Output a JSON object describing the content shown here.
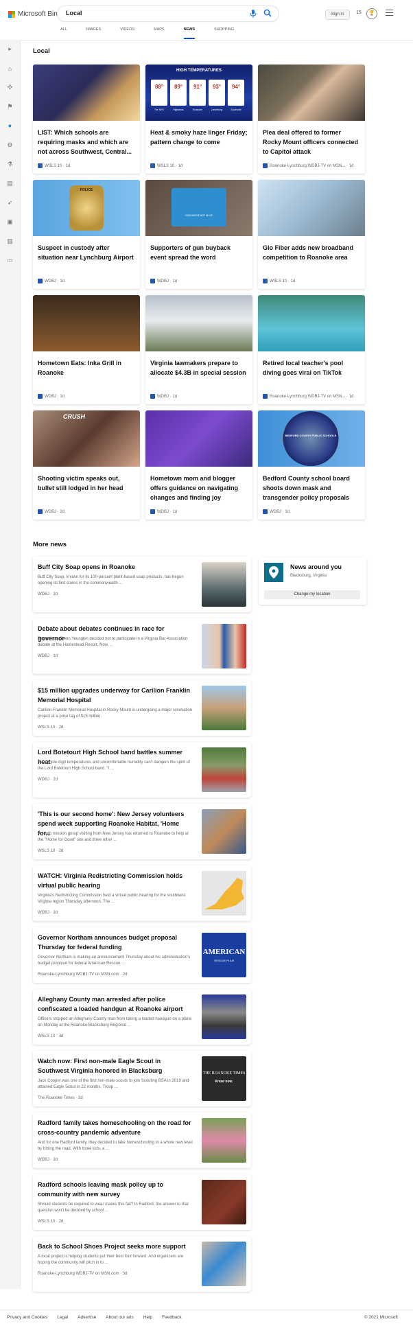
{
  "header": {
    "brand": "Microsoft Bing",
    "query": "Local",
    "signin": "Sign in",
    "rewards_count": "15",
    "tabs": [
      "ALL",
      "IMAGES",
      "VIDEOS",
      "MAPS",
      "NEWS",
      "SHOPPING"
    ],
    "active_tab": "NEWS"
  },
  "local": {
    "title": "Local",
    "cards": [
      {
        "title": "LIST: Which schools are requiring masks and which are not across Southwest, Central...",
        "source": "WSLS 10",
        "age": "1d"
      },
      {
        "title": "Heat & smoky haze linger Friday; pattern change to come",
        "source": "WSLS 10",
        "age": "1d",
        "img_text": "HIGH TEMPERATURES",
        "temps": [
          "88°",
          "89°",
          "91°",
          "93°",
          "94°"
        ],
        "towns": [
          "The NRV",
          "Highlands",
          "Roanoke",
          "Lynchburg",
          "Southside"
        ]
      },
      {
        "title": "Plea deal offered to former Rocky Mount officers connected to Capitol attack",
        "source": "Roanoke-Lynchburg WDBJ-TV on MSN...",
        "age": "1d"
      },
      {
        "title": "Suspect in custody after situation near Lynchburg Airport",
        "source": "WDBJ",
        "age": "1d",
        "img_text": "POLICE"
      },
      {
        "title": "Supporters of gun buyback event spread the word",
        "source": "WDBJ",
        "age": "1d",
        "img_text": "DISCHARGE NOT ALIVE"
      },
      {
        "title": "Glo Fiber adds new broadband competition to Roanoke area",
        "source": "WSLS 10",
        "age": "1d"
      },
      {
        "title": "Hometown Eats: Inka Grill in Roanoke",
        "source": "WDBJ",
        "age": "1d"
      },
      {
        "title": "Virginia lawmakers prepare to allocate $4.3B in special session",
        "source": "WDBJ",
        "age": "1d"
      },
      {
        "title": "Retired local teacher's pool diving goes viral on TikTok",
        "source": "Roanoke-Lynchburg WDBJ-TV on MSN...",
        "age": "1d"
      },
      {
        "title": "Shooting victim speaks out, bullet still lodged in her head",
        "source": "WDBJ",
        "age": "2d",
        "img_text": "CRUSH"
      },
      {
        "title": "Hometown mom and blogger offers guidance on navigating changes and finding joy",
        "source": "WDBJ",
        "age": "1d"
      },
      {
        "title": "Bedford County school board shoots down mask and transgender policy proposals",
        "source": "WDBJ",
        "age": "1d",
        "img_text": "BEDFORD COUNTY PUBLIC SCHOOLS"
      }
    ]
  },
  "more_news": {
    "title": "More news",
    "items": [
      {
        "title": "Buff City Soap opens in Roanoke",
        "snippet": "Buff City Soap, known for its 100-percent plant-based soap products, has begun opening its first stores in the commonwealth ...",
        "source": "WDBJ",
        "age": "2d"
      },
      {
        "title": "Debate about debates continues in race for governor",
        "snippet": "Republican Glenn Youngkin decided not to participate in a Virginia Bar Association debate at the Homestead Resort. Now, ...",
        "source": "WDBJ",
        "age": "1d"
      },
      {
        "title": "$15 million upgrades underway for Carilion Franklin Memorial Hospital",
        "snippet": "Carilion Franklin Memorial Hospital in Rocky Mount is undergoing a major renovation project at a price tag of $15 million.",
        "source": "WSLS 10",
        "age": "2d"
      },
      {
        "title": "Lord Botetourt High School band battles summer heat",
        "snippet": "Near-triple-digit temperatures and uncomfortable humidity can't dampen the spirit of the Lord Botetourt High School band. \"I ...",
        "source": "WDBJ",
        "age": "2d"
      },
      {
        "title": "'This is our second home': New Jersey volunteers spend week supporting Roanoke Habitat, 'Home for...",
        "snippet": "A youth mission group visiting from New Jersey has returned to Roanoke to help at the \"Home for Good\" site and three other ...",
        "source": "WSLS 10",
        "age": "2d"
      },
      {
        "title": "WATCH: Virginia Redistricting Commission holds virtual public hearing",
        "snippet": "Virginia's Redistricting Commission held a virtual public hearing for the southwest Virginia region Thursday afternoon. The ...",
        "source": "WDBJ",
        "age": "2d"
      },
      {
        "title": "Governor Northam announces budget proposal Thursday for federal funding",
        "snippet": "Governor Northam is making an announcement Thursday about his administration's budget proposal for federal American Rescue ...",
        "source": "Roanoke-Lynchburg WDBJ-TV on MSN.com",
        "age": "2d",
        "img_text": "AMERICAN",
        "img_sub": "RESCUE PLAN"
      },
      {
        "title": "Alleghany County man arrested after police confiscated a loaded handgun at Roanoke airport",
        "snippet": "Officers stopped an Alleghany County man from taking a loaded handgun on a plane on Monday at the Roanoke-Blacksburg Regional ...",
        "source": "WSLS 10",
        "age": "3d"
      },
      {
        "title": "Watch now: First non-male Eagle Scout in Southwest Virginia honored in Blacksburg",
        "snippet": "Jack Cooper was one of the first non-male scouts to join Scouting BSA in 2019 and attained Eagle Scout in 22 months. Troop ...",
        "source": "The Roanoke Times",
        "age": "3d",
        "img_text": "THE ROANOKE TIMES",
        "img_sub": "Know now."
      },
      {
        "title": "Radford family takes homeschooling on the road for cross-country pandemic adventure",
        "snippet": "And for one Radford family, they decided to take homeschooling to a whole new level by hitting the road. With three kids, a ...",
        "source": "WDBJ",
        "age": "2d"
      },
      {
        "title": "Radford schools leaving mask policy up to community with new survey",
        "snippet": "Should students be required to wear masks this fall? In Radford, the answer to that question won't be decided by school ...",
        "source": "WSLS 10",
        "age": "2d"
      },
      {
        "title": "Back to School Shoes Project seeks more support",
        "snippet": "A local project is helping students put their best foot forward. And organizers are hoping the community will pitch in to ...",
        "source": "Roanoke-Lynchburg WDBJ-TV on MSN.com",
        "age": "3d"
      }
    ]
  },
  "around": {
    "title": "News around you",
    "location": "Blacksburg, Virginia",
    "button": "Change my location"
  },
  "footer": {
    "links": [
      "Privacy and Cookies",
      "Legal",
      "Advertise",
      "About our ads",
      "Help",
      "Feedback"
    ],
    "copyright": "© 2021 Microsoft"
  },
  "colors": {
    "accent": "#174ae4",
    "pin": "#0f6f8a"
  }
}
